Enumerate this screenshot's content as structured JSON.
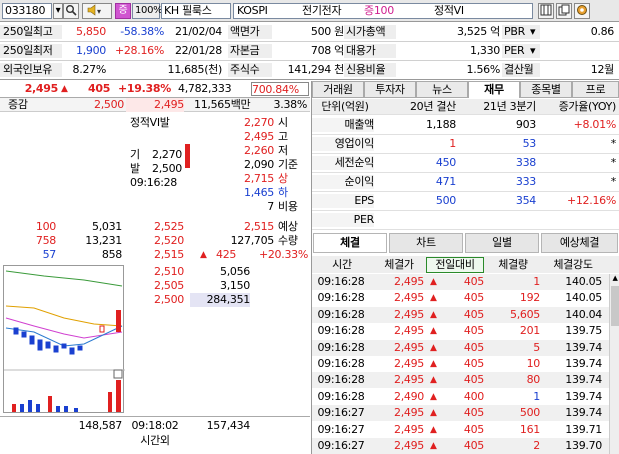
{
  "toolbar": {
    "code": "033180",
    "zoom": "100%",
    "market": "KH 필룩스",
    "exchange": "KOSPI",
    "sector": "전기전자",
    "margin": "증100",
    "status": "정적VI",
    "jeung": "증"
  },
  "summary": {
    "row1": {
      "label": "250일최고",
      "value": "5,850",
      "change": "-58.38%",
      "date": "21/02/04",
      "label2": "액면가",
      "value2": "500 원",
      "label3": "시가총액",
      "value3": "3,525 억",
      "label4": "PBR",
      "value4": "0.86"
    },
    "row2": {
      "label": "250일최저",
      "value": "1,900",
      "change": "+28.16%",
      "date": "22/01/28",
      "label2": "자본금",
      "value2": "708 억",
      "label3": "대용가",
      "value3": "1,330",
      "label4": "PER",
      "value4": ""
    },
    "row3": {
      "label": "외국인보유",
      "value": "8.27%",
      "shares": "11,685(천)",
      "label2": "주식수",
      "value2": "141,294 천",
      "label3": "신용비율",
      "value3": "1.56%",
      "label4": "결산월",
      "value4": "12월"
    }
  },
  "pricebar": {
    "price": "2,495",
    "arrow": "▲",
    "diff": "405",
    "pct": "+19.38%",
    "volume": "4,782,333",
    "ratio": "700.84%"
  },
  "orderbook": {
    "header": {
      "label": "증감",
      "ask_price": "2,500",
      "cur_price": "2,495",
      "amount": "11,565백만",
      "pct": "3.38%"
    },
    "vi_label": "정적VI발",
    "vi_gi_label": "기",
    "vi_gi": "2,270",
    "vi_bal_label": "발",
    "vi_bal": "2,500",
    "vi_time": "09:16:28",
    "info": [
      {
        "value": "2,270",
        "label": "시"
      },
      {
        "value": "2,495",
        "label": "고"
      },
      {
        "value": "2,260",
        "label": "저"
      },
      {
        "value": "2,090",
        "label": "기준"
      },
      {
        "value": "2,715",
        "label": "상"
      },
      {
        "value": "1,465",
        "label": "하"
      },
      {
        "value": "7",
        "label": "비용"
      }
    ],
    "expected_price": "2,515",
    "expected_label": "예상",
    "expected_qty": "127,705",
    "qty_label": "수량",
    "expected_diff": "425",
    "expected_pct": "+20.33%",
    "asks": [
      {
        "chg": "100",
        "qty": "5,031",
        "price": "2,525"
      },
      {
        "chg": "758",
        "qty": "13,231",
        "price": "2,520"
      },
      {
        "chg": "57",
        "qty": "858",
        "price": "2,515"
      }
    ],
    "bids": [
      {
        "price": "2,510",
        "qty": "5,056"
      },
      {
        "price": "2,505",
        "qty": "3,150"
      },
      {
        "price": "2,500",
        "qty": "284,351"
      }
    ],
    "footer": {
      "ask_total": "148,587",
      "time": "09:18:02",
      "bid_total": "157,434",
      "after_label": "시간외"
    }
  },
  "tabs": [
    "거래원",
    "투자자",
    "뉴스",
    "재무",
    "종목별",
    "프로"
  ],
  "finance": {
    "headers": [
      "단위(억원)",
      "20년 결산",
      "21년 3분기",
      "증가율(YOY)"
    ],
    "rows": [
      {
        "label": "매출액",
        "a": "1,188",
        "b": "903",
        "c": "+8.01%"
      },
      {
        "label": "영업이익",
        "a": "1",
        "b": "53",
        "c": "*"
      },
      {
        "label": "세전순익",
        "a": "450",
        "b": "338",
        "c": "*"
      },
      {
        "label": "순이익",
        "a": "471",
        "b": "333",
        "c": "*"
      },
      {
        "label": "EPS",
        "a": "500",
        "b": "354",
        "c": "+12.16%"
      },
      {
        "label": "PER",
        "a": "",
        "b": "",
        "c": ""
      }
    ]
  },
  "trade_tabs": [
    "체결",
    "차트",
    "일별",
    "예상체결"
  ],
  "trades": {
    "headers": [
      "시간",
      "체결가",
      "전일대비",
      "체결량",
      "체결강도"
    ],
    "rows": [
      {
        "t": "09:16:28",
        "p": "2,495",
        "d": "405",
        "q": "1",
        "s": "140.05"
      },
      {
        "t": "09:16:28",
        "p": "2,495",
        "d": "405",
        "q": "192",
        "s": "140.05"
      },
      {
        "t": "09:16:28",
        "p": "2,495",
        "d": "405",
        "q": "5,605",
        "s": "140.04"
      },
      {
        "t": "09:16:28",
        "p": "2,495",
        "d": "405",
        "q": "201",
        "s": "139.75"
      },
      {
        "t": "09:16:28",
        "p": "2,495",
        "d": "405",
        "q": "5",
        "s": "139.74"
      },
      {
        "t": "09:16:28",
        "p": "2,495",
        "d": "405",
        "q": "10",
        "s": "139.74"
      },
      {
        "t": "09:16:28",
        "p": "2,495",
        "d": "405",
        "q": "80",
        "s": "139.74"
      },
      {
        "t": "09:16:28",
        "p": "2,490",
        "d": "400",
        "q": "1",
        "s": "139.74"
      },
      {
        "t": "09:16:27",
        "p": "2,495",
        "d": "405",
        "q": "500",
        "s": "139.74"
      },
      {
        "t": "09:16:27",
        "p": "2,495",
        "d": "405",
        "q": "161",
        "s": "139.71"
      },
      {
        "t": "09:16:27",
        "p": "2,495",
        "d": "405",
        "q": "2",
        "s": "139.70"
      }
    ]
  },
  "colors": {
    "up": "#e02020",
    "down": "#1a40d0",
    "accent": "#cc44cc"
  },
  "icons": [
    "search-icon",
    "speaker-icon",
    "window-icon",
    "copy-icon",
    "gear-icon",
    "dropdown-icon"
  ]
}
